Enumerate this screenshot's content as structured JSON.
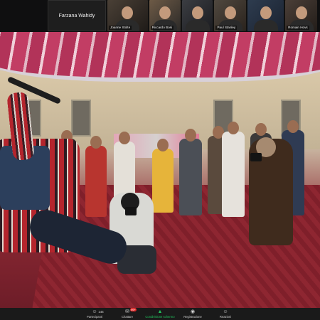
{
  "participants_strip": {
    "name_only_tile": "Farzana Wahidy",
    "video_tiles": [
      {
        "name": "Joanne Stolte"
      },
      {
        "name": "Riccardo Bosi"
      },
      {
        "name": ""
      },
      {
        "name": "Paul Stanley"
      },
      {
        "name": ""
      },
      {
        "name": "Romain Hovs"
      }
    ]
  },
  "toolbar": {
    "items": [
      {
        "icon": "participants-icon",
        "label": "Partecipanti",
        "count": "144"
      },
      {
        "icon": "chat-icon",
        "label": "Chattare",
        "badge": "99+"
      },
      {
        "icon": "share-screen-icon",
        "label": "Condivisione schermo"
      },
      {
        "icon": "record-icon",
        "label": "Registrazione"
      },
      {
        "icon": "reactions-icon",
        "label": "Reazioni"
      }
    ]
  },
  "colors": {
    "share_accent": "#22c55e",
    "badge_red": "#e02828",
    "toolbar_bg": "#1a1a1a"
  }
}
